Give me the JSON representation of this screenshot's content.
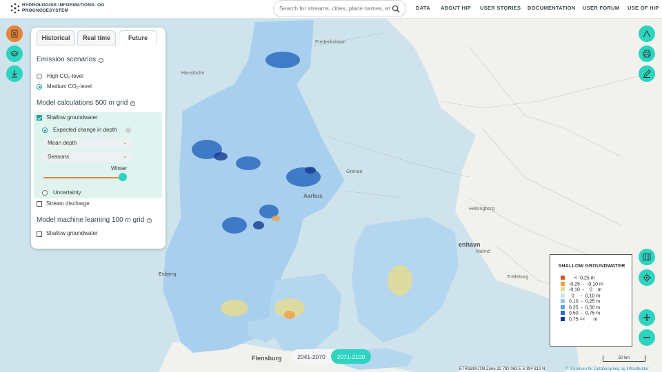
{
  "header": {
    "brand_line1": "HYDROLOGISK INFORMATIONS- OG",
    "brand_line2": "PROGNOSESYSTEM",
    "search_placeholder": "Search for streams, cities, place names, etc.",
    "nav": [
      "DATA",
      "ABOUT HIP",
      "USER STORIES",
      "DOCUMENTATION",
      "USER FORUM",
      "USE OF HIP"
    ]
  },
  "panel": {
    "tabs": [
      "Historical",
      "Real time",
      "Future"
    ],
    "active_tab": "Future",
    "emission_title": "Emission scenarios",
    "emission_options": [
      "High CO₂-level",
      "Medium CO₂-level"
    ],
    "emission_selected": "Medium CO₂-level",
    "model500_title": "Model calculations 500 m grid",
    "shallow_label": "Shallow groundwater",
    "shallow_checked": true,
    "expected_label": "Expected change in depth",
    "select_depth": "Mean depth",
    "select_season": "Seasons",
    "season_value": "Winter",
    "uncertainty_label": "Uncertainty",
    "stream_label": "Stream discharge",
    "ml_title": "Model machine learning 100 m grid",
    "ml_shallow_label": "Shallow groundwater"
  },
  "legend": {
    "title": "SHALLOW GROUNDWATER",
    "items": [
      {
        "label": "    < -0,25 m",
        "color": "#d9502a"
      },
      {
        "label": "-0,25  -  -0,10 m",
        "color": "#f0a040"
      },
      {
        "label": "-0,10  -    0    m",
        "color": "#e8dc8c"
      },
      {
        "label": "  0     -  0,10 m",
        "color": "#cfe3f4"
      },
      {
        "label": "0,10  -  0,25 m",
        "color": "#9cc8ea"
      },
      {
        "label": "0,25  -  0,50 m",
        "color": "#5f9fdc"
      },
      {
        "label": "0,50  -  0,75 m",
        "color": "#2e6cc0"
      },
      {
        "label": "0,75 =<      m",
        "color": "#173a8e"
      }
    ]
  },
  "periods": {
    "option1": "2041-2070",
    "option2": "2071-2100",
    "active": "2071-2100"
  },
  "scale_label": "50 km",
  "footer": {
    "coords": "ETRS89/UTM Zone 32   782 063 E   6 394 813 N",
    "attribution": "© Styrelsen for Dataforsyning og Infrastruktur"
  },
  "map_labels": {
    "frederikshavn": "Frederikshavn",
    "hanstholm": "Hanstholm",
    "aarhus": "Aarhus",
    "esbjerg": "Esbjerg",
    "flensburg": "Flensburg",
    "kobenhavn": "enhavn",
    "malmo": "Malmö",
    "trelleborg": "Trelleborg",
    "grenaa": "Grenaa",
    "helsingborg": "Helsingborg"
  },
  "colors": {
    "accent": "#2dd4bf",
    "orange": "#e8833a",
    "land": "#a8d0ee",
    "sea": "#cfe3ec",
    "sweden": "#f2f2f0"
  }
}
